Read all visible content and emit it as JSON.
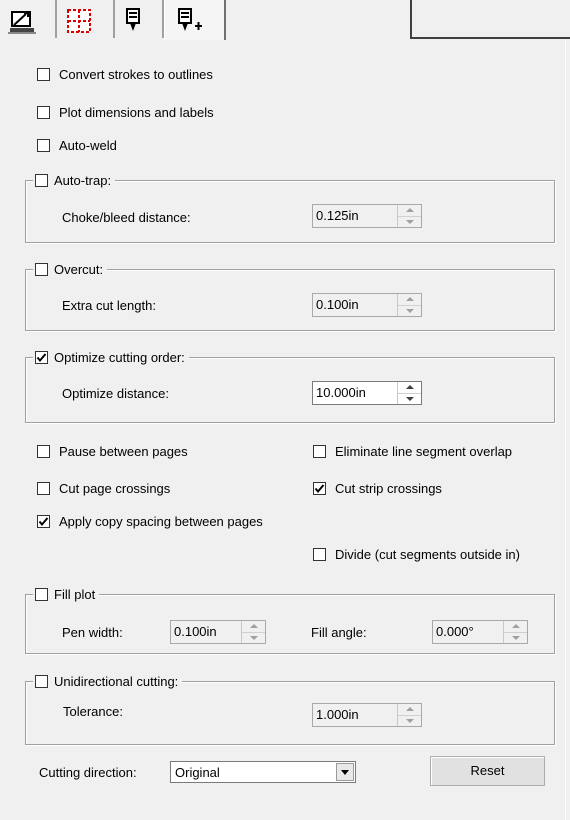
{
  "tabs": [
    {
      "icon": "plot-settings-icon"
    },
    {
      "icon": "page-layout-icon"
    },
    {
      "icon": "pen-tool-icon"
    },
    {
      "icon": "pen-tool-plus-icon",
      "active": true
    }
  ],
  "options": {
    "convert_strokes": {
      "label": "Convert strokes to outlines",
      "checked": false
    },
    "plot_dimensions": {
      "label": "Plot dimensions and labels",
      "checked": false
    },
    "auto_weld": {
      "label": "Auto-weld",
      "checked": false
    }
  },
  "auto_trap": {
    "label": "Auto-trap:",
    "checked": false,
    "field_label": "Choke/bleed distance:",
    "value": "0.125in"
  },
  "overcut": {
    "label": "Overcut:",
    "checked": false,
    "field_label": "Extra cut length:",
    "value": "0.100in"
  },
  "optimize": {
    "label": "Optimize cutting order:",
    "checked": true,
    "field_label": "Optimize distance:",
    "value": "10.000in"
  },
  "misc": {
    "pause_pages": {
      "label": "Pause between pages",
      "checked": false
    },
    "eliminate_overlap": {
      "label": "Eliminate line segment overlap",
      "checked": false
    },
    "cut_page_crossings": {
      "label": "Cut page crossings",
      "checked": false
    },
    "cut_strip_crossings": {
      "label": "Cut strip crossings",
      "checked": true
    },
    "apply_copy_spacing": {
      "label": "Apply copy spacing between pages",
      "checked": true
    },
    "divide": {
      "label": "Divide (cut segments outside in)",
      "checked": false
    }
  },
  "fill_plot": {
    "label": "Fill plot",
    "checked": false,
    "pen_width_label": "Pen width:",
    "pen_width": "0.100in",
    "fill_angle_label": "Fill angle:",
    "fill_angle": "0.000°"
  },
  "unidirectional": {
    "label": "Unidirectional cutting:",
    "checked": false,
    "field_label": "Tolerance:",
    "value": "1.000in"
  },
  "cutting_direction": {
    "label": "Cutting direction:",
    "value": "Original"
  },
  "reset_label": "Reset"
}
